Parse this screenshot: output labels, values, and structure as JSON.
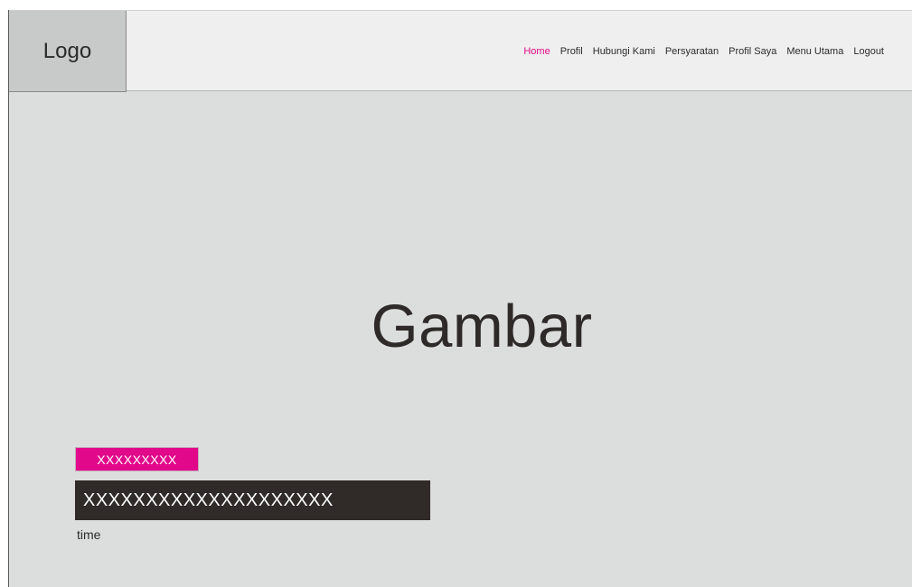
{
  "header": {
    "logo": "Logo",
    "nav": [
      {
        "label": "Home",
        "active": true
      },
      {
        "label": "Profil",
        "active": false
      },
      {
        "label": "Hubungi Kami",
        "active": false
      },
      {
        "label": "Persyaratan",
        "active": false
      },
      {
        "label": "Profil Saya",
        "active": false
      },
      {
        "label": "Menu Utama",
        "active": false
      },
      {
        "label": "Logout",
        "active": false
      }
    ]
  },
  "hero": {
    "image_label": "Gambar",
    "tag": "XXXXXXXXX",
    "headline": "XXXXXXXXXXXXXXXXXXXX",
    "time": "time"
  },
  "colors": {
    "accent": "#e2088a",
    "dark": "#302a29",
    "header_bg": "#efefef",
    "body_bg": "#dcdedd",
    "logo_bg": "#c8c9c9"
  }
}
